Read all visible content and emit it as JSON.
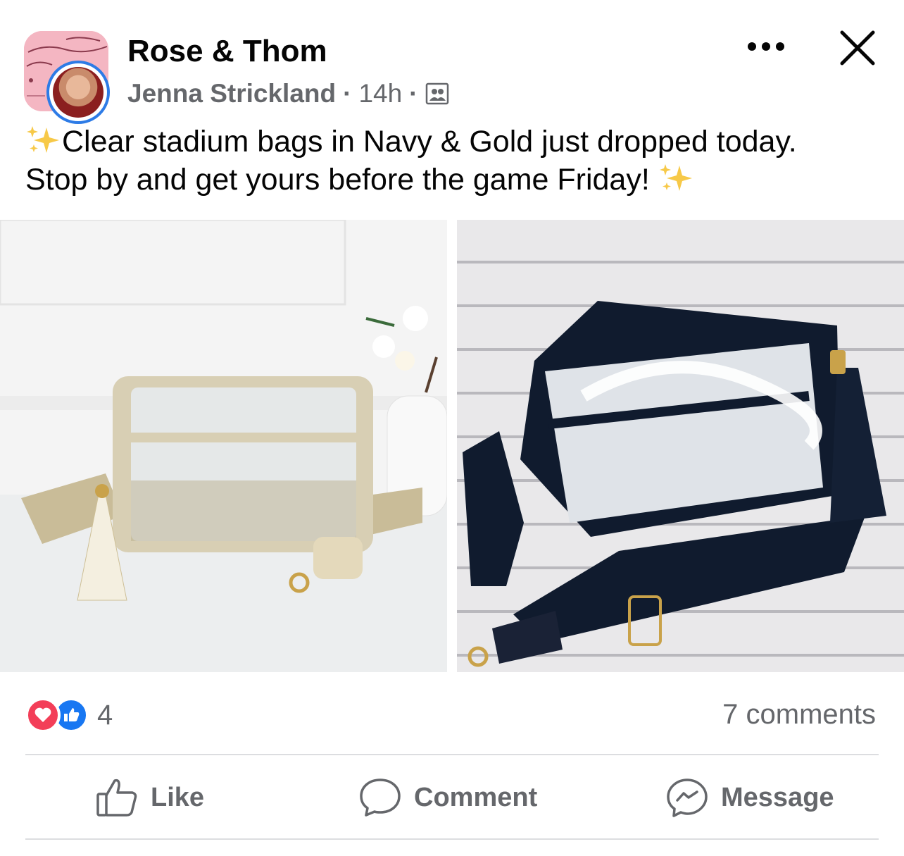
{
  "header": {
    "page_name": "Rose & Thom",
    "author": "Jenna Strickland",
    "separator": "·",
    "time": "14h",
    "audience_icon": "group-audience-icon",
    "more_icon": "more-horizontal-icon",
    "close_icon": "close-icon"
  },
  "post": {
    "line1": "Clear stadium bags in Navy & Gold just dropped today.",
    "line2": "Stop by and get yours before the game Friday!",
    "emoji": "sparkles-icon"
  },
  "photos": [
    {
      "name": "gold-clear-bag-photo",
      "subject": "gold"
    },
    {
      "name": "navy-clear-bag-photo",
      "subject": "navy"
    }
  ],
  "engagement": {
    "reaction_count": "4",
    "comments": "7 comments",
    "reactions": [
      "love",
      "like"
    ]
  },
  "actions": {
    "like": "Like",
    "comment": "Comment",
    "message": "Message"
  },
  "colors": {
    "accent_blue": "#1877f2",
    "love_red": "#f33e58",
    "secondary_text": "#65676b"
  }
}
